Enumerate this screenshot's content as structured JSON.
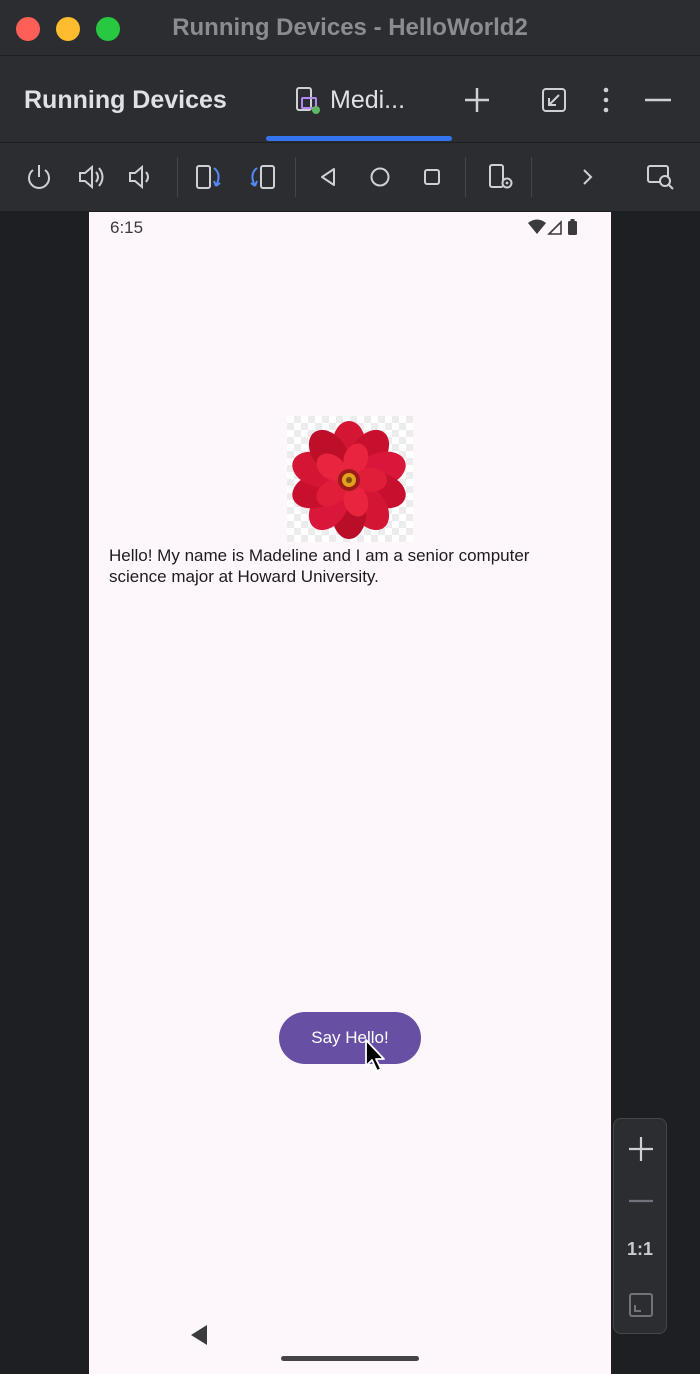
{
  "window": {
    "title": "Running Devices - HelloWorld2"
  },
  "panel": {
    "title": "Running Devices"
  },
  "tabs": [
    {
      "label": "Medi..."
    }
  ],
  "device": {
    "status_time": "6:15",
    "bio_text": "Hello! My name is Madeline and I am a senior computer science major at Howard University.",
    "button_label": "Say Hello!",
    "image": "flower-image"
  },
  "zoom": {
    "actual_size_label": "1:1"
  },
  "icons": {
    "power": "power-icon",
    "volume_up": "volume-up-icon",
    "volume_down": "volume-down-icon",
    "rotate_left": "rotate-left-icon",
    "rotate_right": "rotate-right-icon",
    "back": "back-icon",
    "home": "home-icon",
    "overview": "overview-icon",
    "device_settings": "device-settings-icon",
    "more": "chevron-right-icon",
    "inspect": "inspect-icon"
  },
  "colors": {
    "accent": "#3574f0",
    "button": "#6750a4",
    "screen_bg": "#fdf7fb",
    "ide_bg": "#2b2d30"
  }
}
